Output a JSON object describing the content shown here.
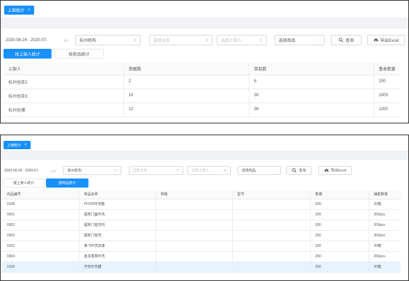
{
  "colors": {
    "accent": "#1890ff",
    "grey_band": "#f0f2f5",
    "row_highlight": "#e6f4ff"
  },
  "top": {
    "tab_label": "上架统计",
    "tab_close": "×",
    "date_range": "2020-06-24 - 2020-07-",
    "org_value": "杭州机构",
    "warehouse_placeholder": "选择仓库",
    "shelver_placeholder": "选择上架人",
    "product_value": "选择商品",
    "product_suffix": "···",
    "query_label": "查询",
    "export_label": "导出Excel",
    "subtabs": {
      "by_shelver": "按上架人统计",
      "by_product": "按商品统计"
    },
    "columns": [
      "上架人",
      "单据数",
      "单品数",
      "基本数量"
    ],
    "rows": [
      [
        "杭州仓库2",
        "2",
        "6",
        "200"
      ],
      [
        "杭州仓库3",
        "10",
        "30",
        "1003"
      ],
      [
        "杭州仓储",
        "12",
        "36",
        "1200"
      ]
    ]
  },
  "bottom": {
    "tab_label": "上架统计",
    "tab_close": "×",
    "date_range": "2020-06-24 - 2020-07-",
    "org_value": "杭州机构",
    "warehouse_placeholder": "选择仓库",
    "shelver_placeholder": "选择上架人",
    "product_value": "选择商品",
    "product_suffix": "···",
    "query_label": "查询",
    "export_label": "导出Excel",
    "subtabs": {
      "by_shelver": "按上架人统计",
      "by_product": "按商品统计"
    },
    "columns": [
      "商品编号",
      "商品名称",
      "规格",
      "型号",
      "数量",
      "辅助数量"
    ],
    "rows": [
      [
        "0108",
        "POOP环洗器",
        "",
        "",
        "200",
        "20箱"
      ],
      [
        "0301",
        "福地门面环洗",
        "",
        "",
        "200",
        "200pcs"
      ],
      [
        "0302",
        "福地门窗洗剂",
        "",
        "",
        "200",
        "200pcs"
      ],
      [
        "0303",
        "福地门窗洗",
        "",
        "",
        "200",
        "200pcs"
      ],
      [
        "0102",
        "美飞环洗加速",
        "",
        "",
        "200",
        "20箱"
      ],
      [
        "0304",
        "金龙香果环洗",
        "",
        "",
        "200",
        "200pcs"
      ],
      [
        "0106",
        "开拓环洗器",
        "",
        "",
        "200",
        "20箱"
      ]
    ]
  }
}
